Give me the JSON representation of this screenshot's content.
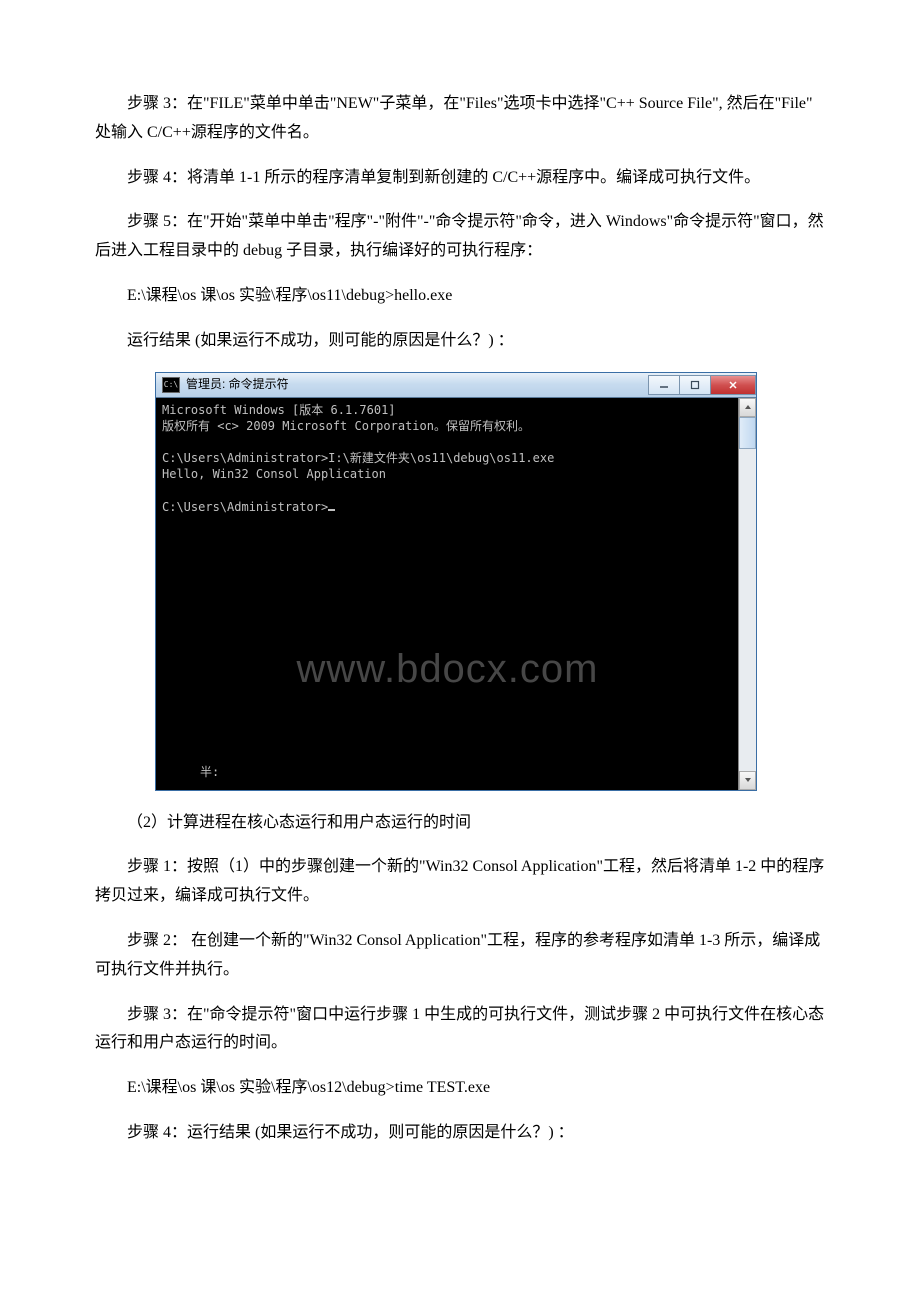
{
  "paragraphs": {
    "p1": "步骤 3：在\"FILE\"菜单中单击\"NEW\"子菜单，在\"Files\"选项卡中选择\"C++ Source File\", 然后在\"File\" 处输入 C/C++源程序的文件名。",
    "p2": "步骤 4：将清单 1-1 所示的程序清单复制到新创建的 C/C++源程序中。编译成可执行文件。",
    "p3": "步骤 5：在\"开始\"菜单中单击\"程序\"-\"附件\"-\"命令提示符\"命令，进入 Windows\"命令提示符\"窗口，然后进入工程目录中的 debug 子目录，执行编译好的可执行程序：",
    "p4": "E:\\课程\\os 课\\os 实验\\程序\\os11\\debug>hello.exe",
    "p5": "运行结果 (如果运行不成功，则可能的原因是什么？) ：",
    "p6": "（2）计算进程在核心态运行和用户态运行的时间",
    "p7": "步骤 1：按照（1）中的步骤创建一个新的\"Win32 Consol Application\"工程，然后将清单 1-2 中的程序拷贝过来，编译成可执行文件。",
    "p8": "步骤 2： 在创建一个新的\"Win32 Consol Application\"工程，程序的参考程序如清单 1-3 所示，编译成可执行文件并执行。",
    "p9": "步骤 3：在\"命令提示符\"窗口中运行步骤 1 中生成的可执行文件，测试步骤 2 中可执行文件在核心态运行和用户态运行的时间。",
    "p10": "E:\\课程\\os 课\\os 实验\\程序\\os12\\debug>time TEST.exe",
    "p11": "步骤 4：运行结果 (如果运行不成功，则可能的原因是什么？) ："
  },
  "cmd": {
    "icon_glyph": "C:\\",
    "title": "管理员: 命令提示符",
    "lines": "Microsoft Windows [版本 6.1.7601]\n版权所有 <c> 2009 Microsoft Corporation。保留所有权利。\n\nC:\\Users\\Administrator>I:\\新建文件夹\\os11\\debug\\os11.exe\nHello, Win32 Consol Application\n\nC:\\Users\\Administrator>",
    "ime": "半:",
    "watermark": "www.bdocx.com"
  }
}
